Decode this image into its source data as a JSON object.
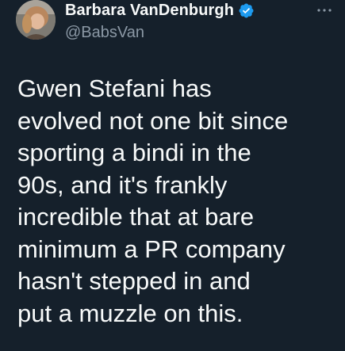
{
  "tweet": {
    "author": {
      "display_name": "Barbara VanDenburgh",
      "handle": "@BabsVan",
      "verified": true,
      "avatar": "author-avatar"
    },
    "more_icon": "more-horizontal-icon",
    "text_lines": [
      "Gwen Stefani has",
      "evolved not one bit since",
      "sporting a bindi in the",
      "90s, and it's frankly",
      "incredible that at bare",
      "minimum a PR company",
      "hasn't stepped in and",
      "put a muzzle on this."
    ]
  },
  "colors": {
    "background": "#15202b",
    "text_primary": "#f7f9f9",
    "text_secondary": "#8b98a5",
    "verified_blue": "#1d9bf0"
  }
}
